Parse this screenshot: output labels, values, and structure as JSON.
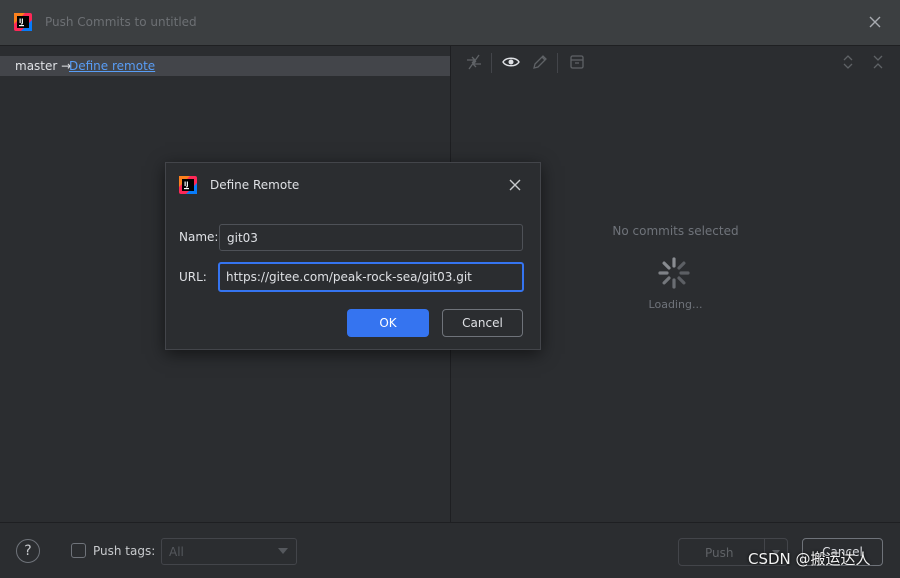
{
  "window": {
    "title": "Push Commits to untitled"
  },
  "branch_panel": {
    "branch": "master →",
    "remote_link": "Define remote"
  },
  "right_panel": {
    "empty_text": "No commits selected",
    "loading_text": "Loading..."
  },
  "toolbar_icons": [
    "move-icon",
    "eye-icon",
    "pencil-icon",
    "archive-icon",
    "expand-icon",
    "collapse-icon"
  ],
  "dialog": {
    "title": "Define Remote",
    "name_label": "Name:",
    "name_value": "git03",
    "url_label": "URL:",
    "url_value": "https://gitee.com/peak-rock-sea/git03.git",
    "ok_label": "OK",
    "cancel_label": "Cancel"
  },
  "bottom": {
    "help": "?",
    "push_tags_label": "Push tags:",
    "tags_value": "All",
    "push_label": "Push",
    "cancel_label": "Cancel"
  },
  "watermark": "CSDN @搬运达人",
  "colors": {
    "accent": "#3574f0",
    "link": "#589df6",
    "background": "#2b2d30"
  }
}
